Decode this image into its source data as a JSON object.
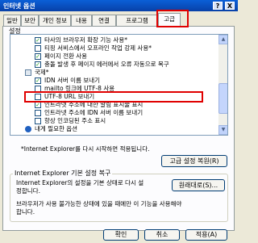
{
  "window": {
    "title": "인터넷 옵션",
    "help_glyph": "?",
    "close_glyph": "X"
  },
  "tabs": [
    {
      "label": "일반",
      "active": false
    },
    {
      "label": "보안",
      "active": false
    },
    {
      "label": "개인 정보",
      "active": false
    },
    {
      "label": "내용",
      "active": false
    },
    {
      "label": "연결",
      "active": false
    },
    {
      "label": "프로그램",
      "active": false
    },
    {
      "label": "고급",
      "active": true
    }
  ],
  "settings": {
    "section_label": "설정",
    "items": [
      {
        "type": "checkbox",
        "checked": true,
        "label": "타사의 브라우저 확장 기능 사용*"
      },
      {
        "type": "checkbox",
        "checked": false,
        "label": "티핑 서비스에서 오프라인 작업 강제 사용*"
      },
      {
        "type": "checkbox",
        "checked": true,
        "label": "페이지 전환 사용"
      },
      {
        "type": "checkbox",
        "checked": true,
        "label": "충돌 발생 후 페이지 에러에서 오류 자동으로 복구"
      },
      {
        "type": "category",
        "label": "국제*"
      },
      {
        "type": "checkbox",
        "checked": true,
        "label": "IDN 서버 이름 보내기"
      },
      {
        "type": "checkbox",
        "checked": false,
        "label": "mailto 링크에 UTF-8 사용"
      },
      {
        "type": "checkbox",
        "checked": false,
        "label": "UTF-8 URL 보내기"
      },
      {
        "type": "checkbox",
        "checked": true,
        "label": "인트라넷 주소에 대한 알림 표시줄 표시"
      },
      {
        "type": "checkbox",
        "checked": false,
        "label": "인트라넷 주소에 IDN 서버 이름 보내기"
      },
      {
        "type": "checkbox",
        "checked": false,
        "label": "항상 인코딩된 주소 표시"
      },
      {
        "type": "info",
        "label": "내게 필요한 옵션"
      }
    ],
    "restart_note": "*Internet Explorer를 다시 시작하면 적용됩니다.",
    "restore_advanced_button": "고급 설정 복원(R)"
  },
  "reset_group": {
    "legend": "Internet Explorer 기본 설정 복구",
    "description_line1": "Internet Explorer의 설정을 기본 상태로 다시 설",
    "description_line2": "정합니다.",
    "reset_button": "원래대로(S)...",
    "warning_line1": "브라우저가 사용 불가능한 상태에 있을 때에만 이 기능을 사용해야",
    "warning_line2": "합니다."
  },
  "footer": {
    "ok": "확인",
    "cancel": "취소",
    "apply": "적용(A)"
  },
  "colors": {
    "highlight_box": "#e00000",
    "checkmark": "#21a121",
    "titlebar": "#0a5fd7"
  }
}
